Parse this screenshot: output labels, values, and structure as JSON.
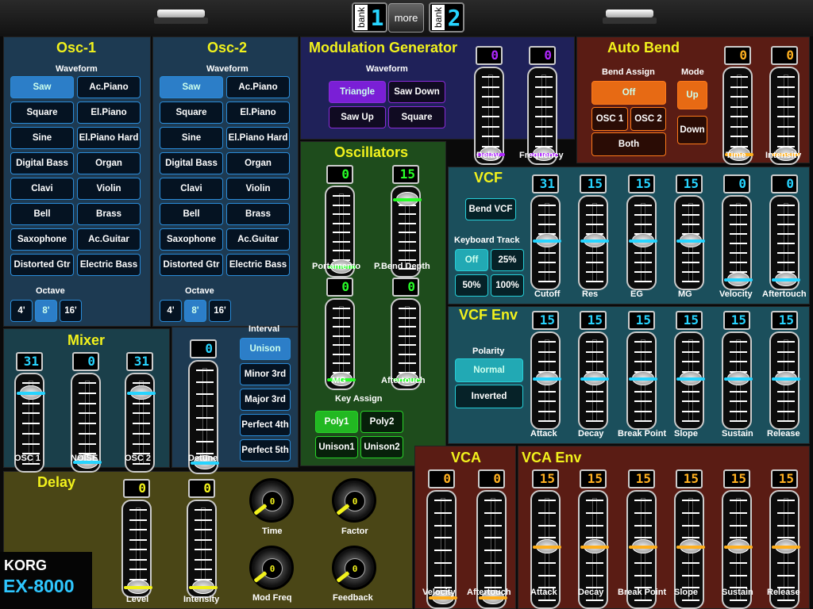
{
  "topbar": {
    "bank_label": "bank",
    "bank1": "1",
    "more": "more",
    "bank2": "2"
  },
  "osc1": {
    "title": "Osc-1",
    "waveform_label": "Waveform",
    "octave_label": "Octave"
  },
  "osc2": {
    "title": "Osc-2",
    "waveform_label": "Waveform",
    "octave_label": "Octave"
  },
  "waveforms": [
    "Saw",
    "Ac.Piano",
    "Square",
    "El.Piano",
    "Sine",
    "El.Piano Hard",
    "Digital Bass",
    "Organ",
    "Clavi",
    "Violin",
    "Bell",
    "Brass",
    "Saxophone",
    "Ac.Guitar",
    "Distorted Gtr",
    "Electric Bass"
  ],
  "octaves": [
    "4'",
    "8'",
    "16'"
  ],
  "mixer": {
    "title": "Mixer",
    "osc1": "OSC 1",
    "noise": "NOISE",
    "osc2": "OSC 2",
    "v_osc1": "31",
    "v_noise": "0",
    "v_osc2": "31",
    "detune": "Detune",
    "v_detune": "0"
  },
  "interval": {
    "label": "Interval",
    "items": [
      "Unison",
      "Minor 3rd",
      "Major 3rd",
      "Perfect 4th",
      "Perfect 5th"
    ]
  },
  "modgen": {
    "title": "Modulation Generator",
    "waveform_label": "Waveform",
    "waves": [
      "Triangle",
      "Saw Down",
      "Saw Up",
      "Square"
    ],
    "delay": "Delay",
    "frequency": "Frequency",
    "v_delay": "0",
    "v_frequency": "0"
  },
  "autobend": {
    "title": "Auto Bend",
    "assign_label": "Bend Assign",
    "off": "Off",
    "osc1": "OSC 1",
    "osc2": "OSC 2",
    "both": "Both",
    "mode_label": "Mode",
    "up": "Up",
    "down": "Down",
    "time": "Time",
    "intensity": "Intensity",
    "v_time": "0",
    "v_intensity": "0"
  },
  "oscillators": {
    "title": "Oscillators",
    "portamento": "Portamento",
    "pbend": "P.Bend Depth",
    "mg": "MG",
    "aftertouch": "Aftertouch",
    "v_portamento": "0",
    "v_pbend": "15",
    "v_mg": "0",
    "v_aftertouch": "0",
    "key_assign": "Key Assign",
    "keys": [
      "Poly1",
      "Poly2",
      "Unison1",
      "Unison2"
    ]
  },
  "vcf": {
    "title": "VCF",
    "bend": "Bend VCF",
    "kbd_label": "Keyboard Track",
    "kbd": [
      "Off",
      "25%",
      "50%",
      "100%"
    ],
    "labels": [
      "Cutoff",
      "Res",
      "EG",
      "MG",
      "Velocity",
      "Aftertouch"
    ],
    "values": [
      "31",
      "15",
      "15",
      "15",
      "0",
      "0"
    ]
  },
  "vcfenv": {
    "title": "VCF Env",
    "polarity_label": "Polarity",
    "normal": "Normal",
    "inverted": "Inverted",
    "labels": [
      "Attack",
      "Decay",
      "Break Point",
      "Slope",
      "Sustain",
      "Release"
    ],
    "values": [
      "15",
      "15",
      "15",
      "15",
      "15",
      "15"
    ]
  },
  "delay": {
    "title": "Delay",
    "level": "Level",
    "intensity": "Intensity",
    "v_level": "0",
    "v_intensity": "0",
    "time": "Time",
    "factor": "Factor",
    "modfreq": "Mod Freq",
    "feedback": "Feedback",
    "dial_value": "0"
  },
  "vca": {
    "title": "VCA",
    "velocity": "Velocity",
    "aftertouch": "Aftertouch",
    "v_velocity": "0",
    "v_aftertouch": "0"
  },
  "vcaenv": {
    "title": "VCA Env",
    "labels": [
      "Attack",
      "Decay",
      "Break Point",
      "Slope",
      "Sustain",
      "Release"
    ],
    "values": [
      "15",
      "15",
      "15",
      "15",
      "15",
      "15"
    ]
  },
  "brand": {
    "korg": "KORG",
    "model": "EX-8000"
  },
  "colors": {
    "title": "#f2f21c",
    "display_cyan": "#27d4ff",
    "display_green": "#28ff28",
    "display_purple": "#b028ff",
    "display_orange": "#ffb020",
    "display_yellow": "#f2f21c"
  }
}
